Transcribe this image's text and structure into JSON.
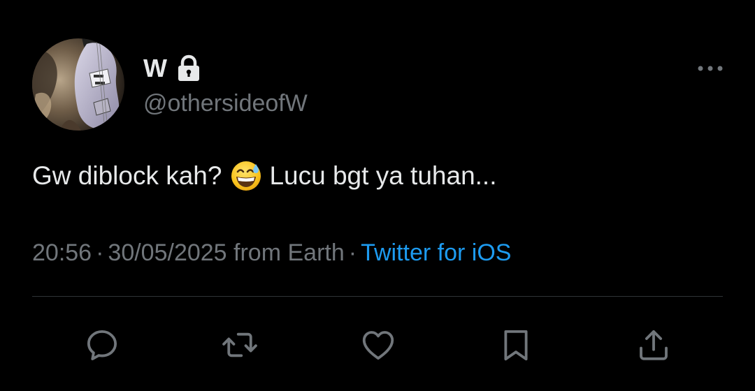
{
  "colors": {
    "background": "#000000",
    "primary_text": "#e7e9ea",
    "secondary_text": "#71767b",
    "link": "#1d9bf0",
    "divider": "#2f3336"
  },
  "author": {
    "display_name": "W",
    "handle": "@othersideofW",
    "avatar_icon": "guitar-photo-avatar",
    "protected_icon": "lock-icon"
  },
  "tweet": {
    "text_before_emoji": "Gw diblock kah?",
    "emoji_icon": "grinning-face-with-sweat-emoji",
    "text_after_emoji": "Lucu bgt ya tuhan..."
  },
  "meta": {
    "time": "20:56",
    "separator": "·",
    "date_location": "30/05/2025 from Earth",
    "source": "Twitter for iOS"
  },
  "actions": {
    "items": [
      {
        "name": "reply",
        "icon": "reply-bubble-icon"
      },
      {
        "name": "retweet",
        "icon": "retweet-icon"
      },
      {
        "name": "like",
        "icon": "heart-icon"
      },
      {
        "name": "bookmark",
        "icon": "bookmark-icon"
      },
      {
        "name": "share",
        "icon": "share-icon"
      }
    ]
  },
  "more_icon": "more-horizontal-icon"
}
